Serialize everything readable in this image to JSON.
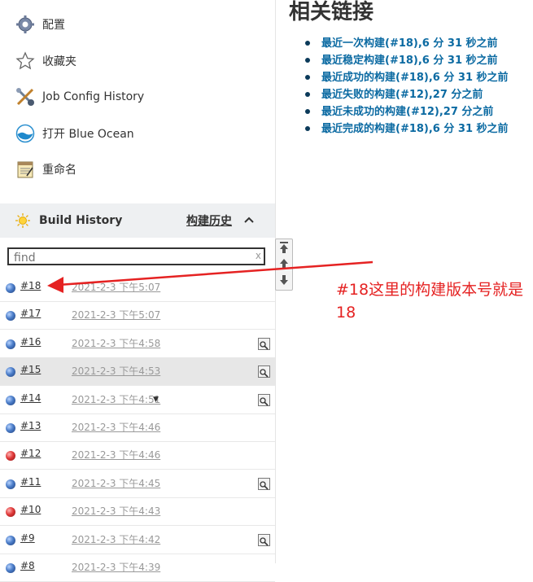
{
  "sidebar": {
    "tasks": [
      {
        "label": "配置",
        "icon": "gear-icon"
      },
      {
        "label": "收藏夹",
        "icon": "star-icon"
      },
      {
        "label": "Job Config History",
        "icon": "tools-icon"
      },
      {
        "label": "打开 Blue Ocean",
        "icon": "blue-ocean-icon"
      },
      {
        "label": "重命名",
        "icon": "notepad-icon"
      }
    ]
  },
  "build_history": {
    "title": "Build History",
    "link": "构建历史",
    "search_placeholder": "find",
    "clear_glyph": "x",
    "builds": [
      {
        "number": "#18",
        "date": "2021-2-3 下午5:07",
        "status": "blue",
        "console": false,
        "dropdown": false
      },
      {
        "number": "#17",
        "date": "2021-2-3 下午5:07",
        "status": "blue",
        "console": false,
        "dropdown": false
      },
      {
        "number": "#16",
        "date": "2021-2-3 下午4:58",
        "status": "blue",
        "console": true,
        "dropdown": false
      },
      {
        "number": "#15",
        "date": "2021-2-3 下午4:53",
        "status": "blue",
        "console": true,
        "dropdown": false
      },
      {
        "number": "#14",
        "date": "2021-2-3 下午4:51",
        "status": "blue",
        "console": true,
        "dropdown": true
      },
      {
        "number": "#13",
        "date": "2021-2-3 下午4:46",
        "status": "blue",
        "console": false,
        "dropdown": false
      },
      {
        "number": "#12",
        "date": "2021-2-3 下午4:46",
        "status": "red",
        "console": false,
        "dropdown": false
      },
      {
        "number": "#11",
        "date": "2021-2-3 下午4:45",
        "status": "blue",
        "console": true,
        "dropdown": false
      },
      {
        "number": "#10",
        "date": "2021-2-3 下午4:43",
        "status": "red",
        "console": false,
        "dropdown": false
      },
      {
        "number": "#9",
        "date": "2021-2-3 下午4:42",
        "status": "blue",
        "console": true,
        "dropdown": false
      },
      {
        "number": "#8",
        "date": "2021-2-3 下午4:39",
        "status": "blue",
        "console": false,
        "dropdown": false
      }
    ]
  },
  "related": {
    "title": "相关链接",
    "links": [
      "最近一次构建(#18),6 分 31 秒之前",
      "最近稳定构建(#18),6 分 31 秒之前",
      "最近成功的构建(#18),6 分 31 秒之前",
      "最近失败的构建(#12),27 分之前",
      "最近未成功的构建(#12),27 分之前",
      "最近完成的构建(#18),6 分 31 秒之前"
    ]
  },
  "annotation": {
    "text": "#18这里的构建版本号就是18",
    "color": "#e52222"
  },
  "colors": {
    "link": "#0b6aa2",
    "header_bg": "#eef0f2",
    "success": "#4a7cc8",
    "failure": "#e03a3a"
  }
}
